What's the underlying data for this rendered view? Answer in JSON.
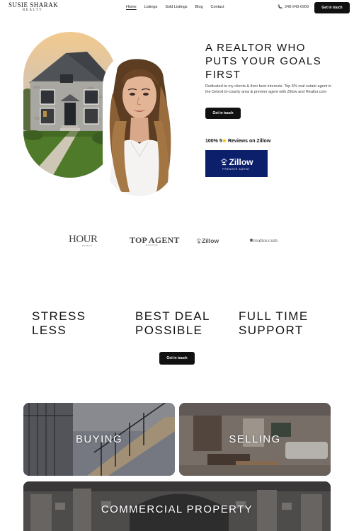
{
  "header": {
    "logo_main": "SUSIE SHARAK",
    "logo_sub": "REALTY",
    "nav": [
      "Home",
      "Listings",
      "Sold Listings",
      "Blog",
      "Contact"
    ],
    "phone": "248-943-6906",
    "cta": "Get in touch"
  },
  "hero": {
    "title": "A REALTOR WHO PUTS YOUR GOALS FIRST",
    "description": "Dedicated to my clients & their best interests. Top 5% real estate agent in the Detroit tri-county area & premier agent with Zillow and Realtor.com",
    "cta": "Get in touch",
    "reviews_prefix": "100% 5",
    "reviews_star": "★",
    "reviews_suffix": " Reviews on Zillow",
    "zillow_badge_title": "Zillow",
    "zillow_badge_sub": "PREMIER AGENT"
  },
  "press": {
    "hour": "HOUR",
    "hour_sub": "DETROIT",
    "top_agent": "TOP AGENT",
    "top_agent_sub": "MAGAZINE",
    "zillow": "Zillow",
    "realtor": "realtor.com"
  },
  "features": {
    "items": [
      "STRESS LESS",
      "BEST DEAL POSSIBLE",
      "FULL TIME SUPPORT"
    ],
    "cta": "Get in touch"
  },
  "services": {
    "buying": "BUYING",
    "selling": "SELLING",
    "commercial": "COMMERCIAL PROPERTY"
  },
  "colors": {
    "button_bg": "#111111",
    "zillow_blue": "#0c1f6b",
    "star": "#f0b400"
  },
  "icons": [
    "phone-icon",
    "zillow-logo-icon",
    "realtor-logo-icon"
  ]
}
